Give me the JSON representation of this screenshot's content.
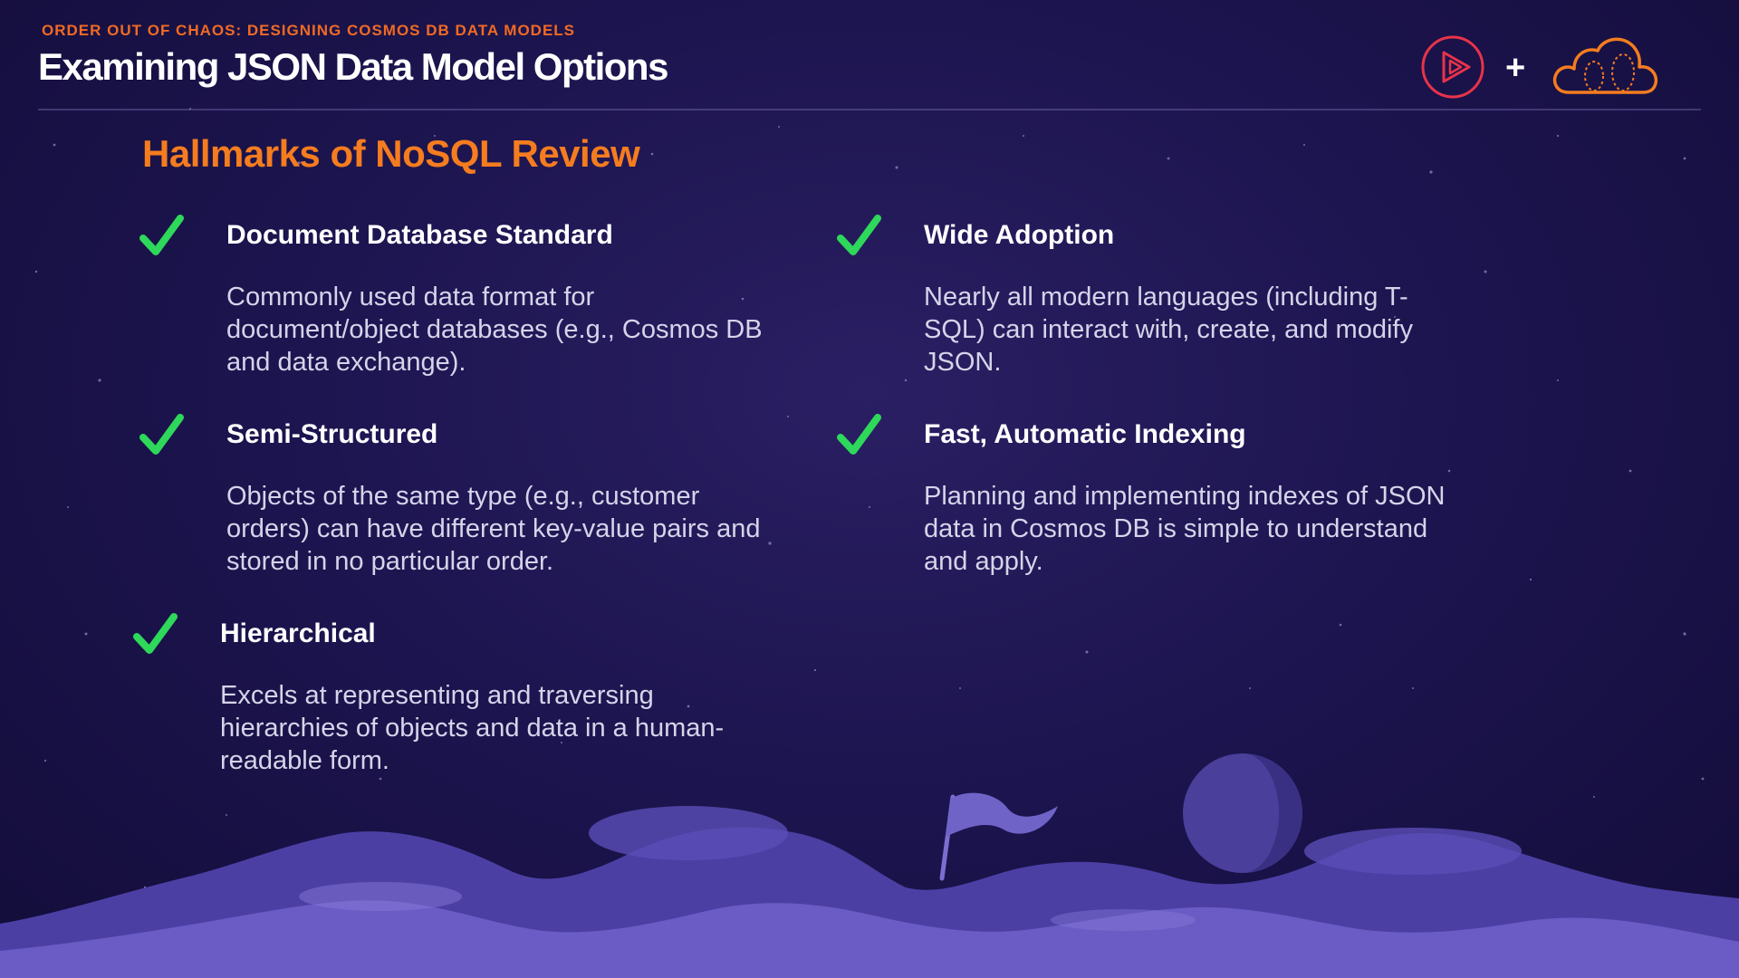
{
  "header": {
    "eyebrow": "ORDER OUT OF CHAOS: DESIGNING COSMOS DB DATA MODELS",
    "title": "Examining JSON Data Model Options",
    "plus": "+"
  },
  "section": {
    "title": "Hallmarks of NoSQL Review"
  },
  "items": [
    {
      "title": "Document Database Standard",
      "description": "Commonly used data format for document/object databases (e.g., Cosmos DB and data exchange).",
      "icon": "checkmark-icon"
    },
    {
      "title": "Semi-Structured",
      "description": "Objects of the same type (e.g., customer orders) can have different key-value pairs and stored in no particular order.",
      "icon": "checkmark-icon"
    },
    {
      "title": "Hierarchical",
      "description": "Excels at representing and traversing hierarchies of objects and data in a human-readable form.",
      "icon": "checkmark-icon"
    },
    {
      "title": "Wide Adoption",
      "description": "Nearly all modern languages (including T-SQL) can interact with, create, and modify JSON.",
      "icon": "checkmark-icon"
    },
    {
      "title": "Fast, Automatic Indexing",
      "description": "Planning and implementing indexes of JSON data in Cosmos DB is simple to understand and apply.",
      "icon": "checkmark-icon"
    }
  ],
  "colors": {
    "accent_orange": "#f57c1f",
    "eyebrow_orange": "#f06a24",
    "check_green": "#2ed85a",
    "background": "#1d1550",
    "play_logo": "#e8334a"
  }
}
